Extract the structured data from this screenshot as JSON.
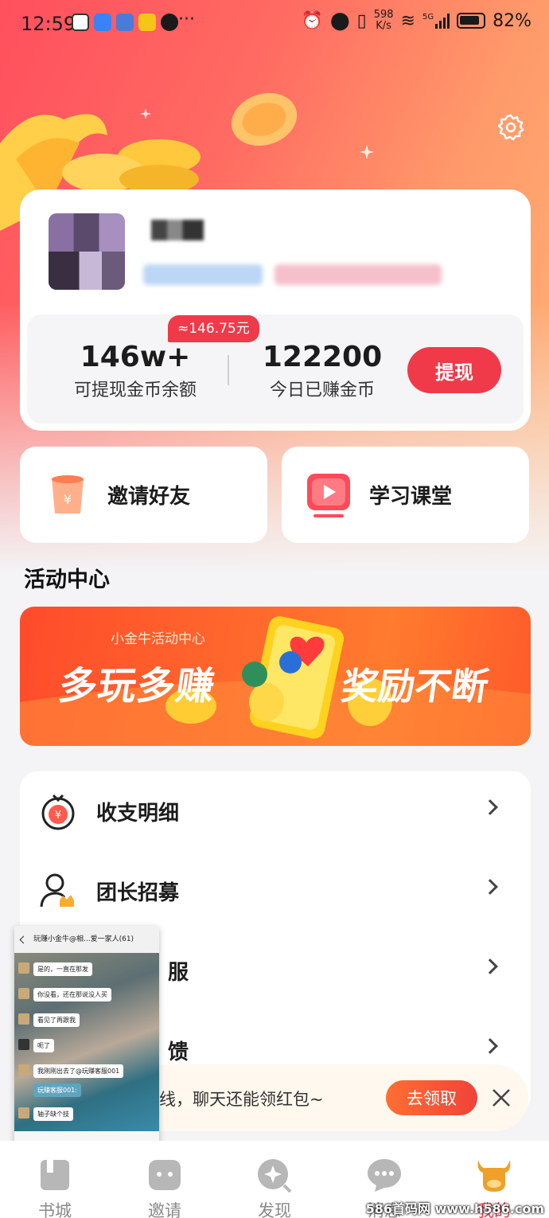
{
  "status_bar": {
    "time": "12:59",
    "more": "···",
    "net_speed_value": "598",
    "net_speed_unit": "K/s",
    "network": "5G",
    "battery": "82%"
  },
  "profile": {
    "avatar_icon": "avatar-blurred",
    "nickname": "",
    "settings_icon": "gear-icon"
  },
  "stats": {
    "rmb_badge": "≈146.75元",
    "withdrawable_value": "146w+",
    "withdrawable_label": "可提现金币余额",
    "today_value": "122200",
    "today_label": "今日已赚金币",
    "withdraw_button": "提现"
  },
  "quick_actions": [
    {
      "label": "邀请好友",
      "icon": "money-cup-icon"
    },
    {
      "label": "学习课堂",
      "icon": "video-play-icon"
    }
  ],
  "activity": {
    "title": "活动中心",
    "banner_sub": "小金牛活动中心",
    "banner_left": "多玩多赚",
    "banner_right": "奖励不断"
  },
  "menu": [
    {
      "label": "收支明细",
      "icon": "coin-bag-icon"
    },
    {
      "label": "团长招募",
      "icon": "leader-icon"
    },
    {
      "label": "服",
      "icon": "service-icon"
    },
    {
      "label": "馈",
      "icon": "feedback-icon"
    }
  ],
  "notice": {
    "text": "线，聊天还能领红包~",
    "button": "去领取",
    "close_icon": "close-icon"
  },
  "floating_chat": {
    "title": "玩赚小金牛@相...爱一家人(61)",
    "messages": [
      "是的，一直在那发",
      "你没看，还在那说没人买",
      "看见了再跟我",
      "呃了",
      "我刚刚出去了@玩赚客服001",
      "玩赚客服001:",
      "轴子缺个技"
    ]
  },
  "tabbar": [
    {
      "label": "书城",
      "icon": "book-icon"
    },
    {
      "label": "邀请",
      "icon": "invite-icon"
    },
    {
      "label": "发现",
      "icon": "discover-icon"
    },
    {
      "label": "消息",
      "icon": "message-icon"
    },
    {
      "label": "我的",
      "icon": "bull-icon",
      "active": true
    }
  ],
  "watermark": "586首码网 www.h586.com",
  "colors": {
    "accent": "#f03a4a",
    "hero_start": "#ff4f5e",
    "hero_end": "#ffb778",
    "notice_button": "#ff6e32"
  }
}
